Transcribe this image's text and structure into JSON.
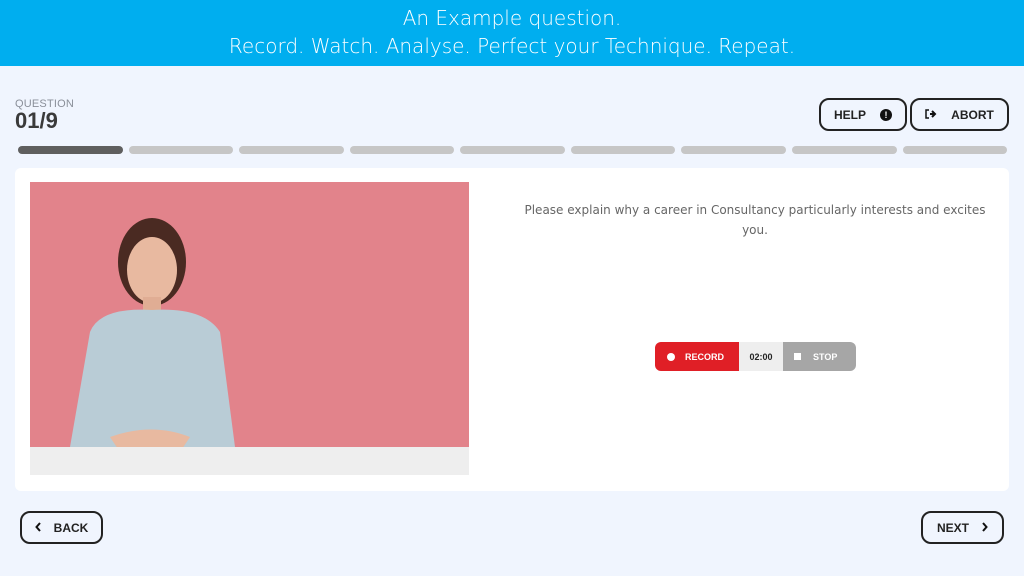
{
  "banner": {
    "line1": "An Example question.",
    "line2": "Record. Watch. Analyse. Perfect your Technique. Repeat."
  },
  "header": {
    "question_label": "QUESTION",
    "question_number": "01/9",
    "help_label": "HELP",
    "help_icon": "info-icon",
    "abort_label": "ABORT",
    "abort_icon": "sign-out-icon"
  },
  "progress": {
    "total_steps": 9,
    "current_step": 1
  },
  "question": {
    "text": "Please explain why a career in Consultancy particularly interests and excites you.",
    "image": "interviewer-woman-photo"
  },
  "recorder": {
    "record_label": "RECORD",
    "timer": "02:00",
    "stop_label": "STOP",
    "record_color": "#e01f26",
    "stop_color": "#a6a6a6"
  },
  "footer": {
    "back_label": "BACK",
    "next_label": "NEXT"
  },
  "colors": {
    "brand": "#00aeef",
    "background": "#f0f5fe"
  }
}
